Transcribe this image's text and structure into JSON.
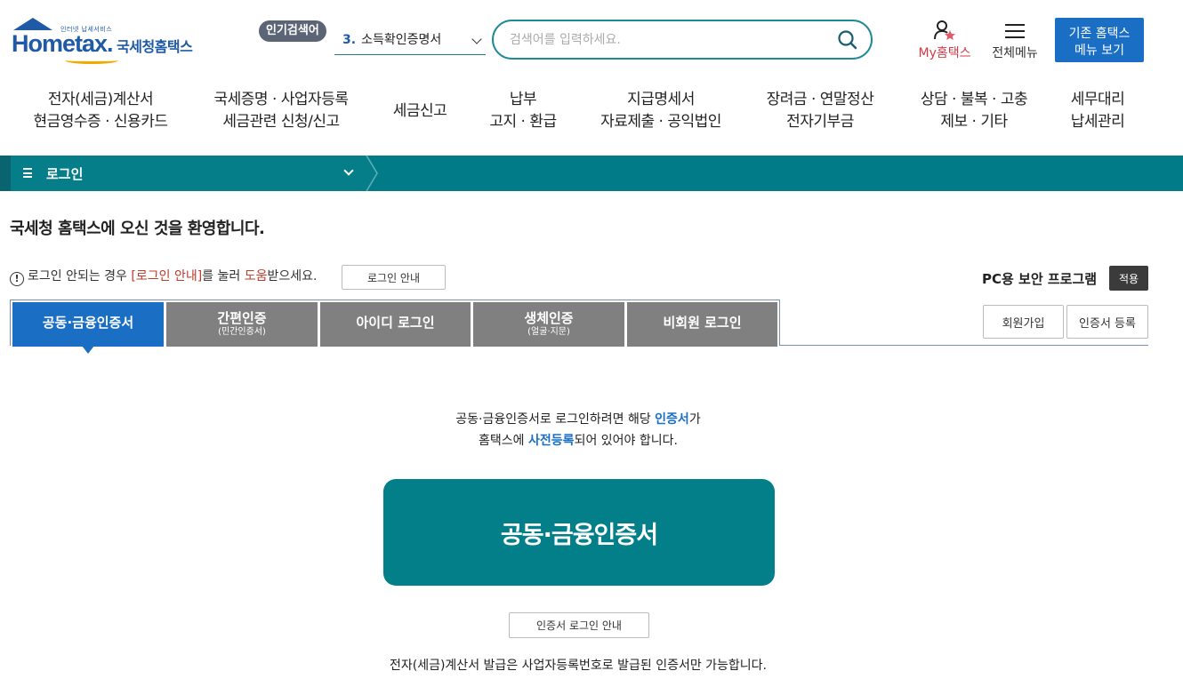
{
  "header": {
    "logo_tagline": "인터넷 납세서비스",
    "logo_main": "Hometax.",
    "logo_sub": "국세청홈택스",
    "popular_badge": "인기검색어",
    "popular_rank": "3.",
    "popular_term": "소득확인증명서",
    "search_placeholder": "검색어를 입력하세요.",
    "my_hometax": "My홈택스",
    "all_menu": "전체메뉴",
    "legacy_line1": "기존 홈택스",
    "legacy_line2": "메뉴 보기"
  },
  "gnb": [
    {
      "line1": "전자(세금)계산서",
      "line2": "현금영수증 · 신용카드"
    },
    {
      "line1": "국세증명 · 사업자등록",
      "line2": "세금관련 신청/신고"
    },
    {
      "line1": "세금신고",
      "line2": ""
    },
    {
      "line1": "납부",
      "line2": "고지 · 환급"
    },
    {
      "line1": "지급명세서",
      "line2": "자료제출 · 공익법인"
    },
    {
      "line1": "장려금 · 연말정산",
      "line2": "전자기부금"
    },
    {
      "line1": "상담 · 불복 · 고충",
      "line2": "제보 · 기타"
    },
    {
      "line1": "세무대리",
      "line2": "납세관리"
    }
  ],
  "location": {
    "label": "로그인"
  },
  "page": {
    "welcome": "국세청 홈택스에 오신 것을 환영합니다.",
    "help_prefix": "로그인 안되는 경우 ",
    "help_link": "[로그인 안내]",
    "help_mid": "를 눌러 ",
    "help_red": "도움",
    "help_suffix": "받으세요.",
    "login_guide_btn": "로그인 안내",
    "pc_security": "PC용 보안 프로그램",
    "apply_btn": "적용",
    "join_btn": "회원가입",
    "cert_register_btn": "인증서 등록"
  },
  "tabs": [
    {
      "main": "공동·금융인증서",
      "sub": "",
      "active": true
    },
    {
      "main": "간편인증",
      "sub": "(민간인증서)",
      "active": false
    },
    {
      "main": "아이디 로그인",
      "sub": "",
      "active": false
    },
    {
      "main": "생체인증",
      "sub": "(얼굴·지문)",
      "active": false
    },
    {
      "main": "비회원 로그인",
      "sub": "",
      "active": false
    }
  ],
  "content": {
    "info1_a": "공동·금융인증서로 로그인하려면 해당 ",
    "info1_b": "인증서",
    "info1_c": "가",
    "info2_a": "홈택스에 ",
    "info2_b": "사전등록",
    "info2_c": "되어 있어야 합니다.",
    "big_button": "공동·금융인증서",
    "cert_guide_btn": "인증서 로그인 안내",
    "notice": "전자(세금)계산서 발급은 사업자등록번호로 발급된 인증서만 가능합니다."
  },
  "colors": {
    "brand_blue": "#1a6fc4",
    "teal": "#037f8a",
    "accent_red": "#c0392b"
  }
}
